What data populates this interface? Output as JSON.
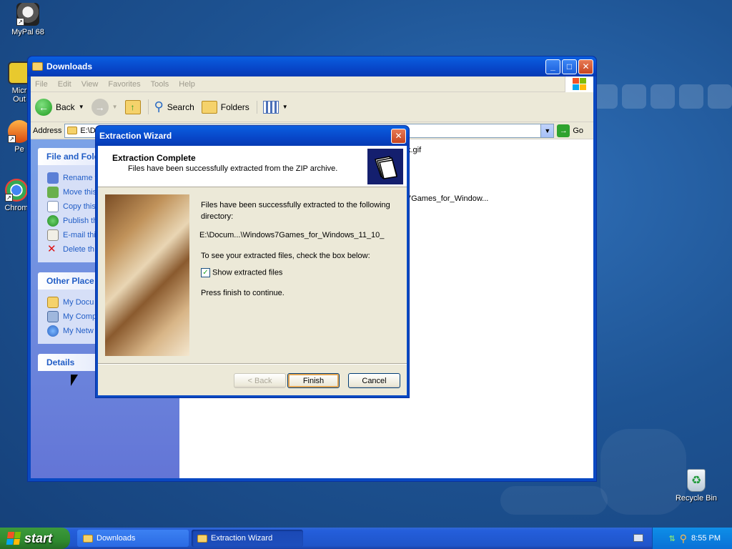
{
  "desktop": {
    "icons": [
      {
        "label": "MyPal 68",
        "icon": "raccoon-icon"
      },
      {
        "label": "Micr\nOut",
        "icon": "outlook-icon"
      },
      {
        "label": "Pe",
        "icon": "app-icon"
      },
      {
        "label": "Chrom",
        "icon": "chrome-icon"
      },
      {
        "label": "Recycle Bin",
        "icon": "recycle-bin-icon"
      }
    ]
  },
  "explorer": {
    "title": "Downloads",
    "menu": [
      "File",
      "Edit",
      "View",
      "Favorites",
      "Tools",
      "Help"
    ],
    "toolbar": {
      "back": "Back",
      "search": "Search",
      "folders": "Folders"
    },
    "address_label": "Address",
    "address_value": "E:\\D",
    "go_label": "Go",
    "left_pane": {
      "file_tasks_title": "File and Fold",
      "file_tasks": [
        "Rename t",
        "Move this",
        "Copy this",
        "Publish th",
        "E-mail thi",
        "Delete th"
      ],
      "other_places_title": "Other Place",
      "other_places": [
        "My Docu",
        "My Comp",
        "My Netw"
      ],
      "details_title": "Details"
    },
    "files_visible": [
      "k.gif",
      "7Games_for_Window..."
    ]
  },
  "dialog": {
    "title": "Extraction Wizard",
    "header_title": "Extraction Complete",
    "header_subtitle": "Files have been successfully extracted from the ZIP archive.",
    "body_line1": "Files have been successfully extracted to the following",
    "body_line2": "directory:",
    "path": "E:\\Docum...\\Windows7Games_for_Windows_11_10_",
    "check_prompt": "To see your extracted files, check the box below:",
    "checkbox_label": "Show extracted files",
    "checkbox_checked": true,
    "finish_prompt": "Press finish to continue.",
    "buttons": {
      "back": "< Back",
      "finish": "Finish",
      "cancel": "Cancel"
    }
  },
  "taskbar": {
    "start": "start",
    "tasks": [
      "Downloads",
      "Extraction Wizard"
    ],
    "clock": "8:55 PM"
  }
}
